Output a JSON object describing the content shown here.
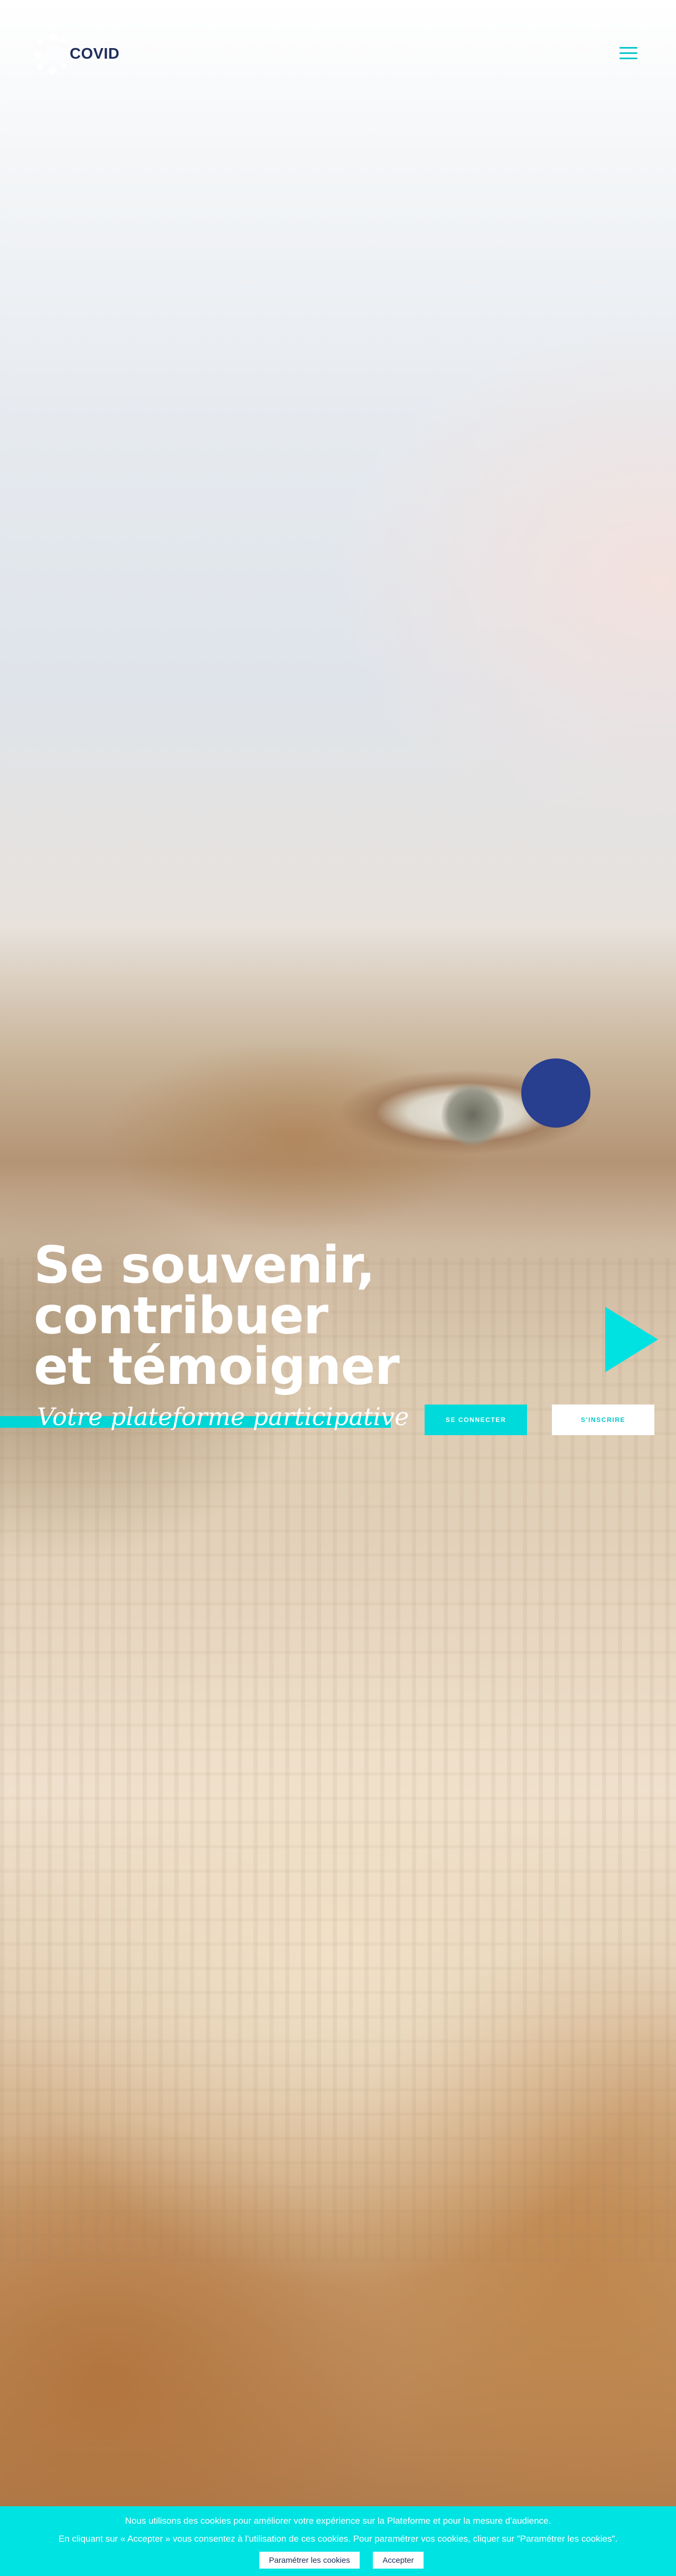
{
  "header": {
    "logo_text": "COVID",
    "logo_icon": "dotted-circle-logo",
    "menu_icon": "hamburger-menu-icon"
  },
  "hero": {
    "title_lines": [
      "Se souvenir,",
      "contribuer",
      "et témoigner"
    ],
    "subtitle": "Votre plateforme participative",
    "login_label": "Se connecter",
    "signup_label": "S'inscrire"
  },
  "cookie_banner": {
    "line1": "Nous utilisons des cookies pour améliorer votre expérience sur la Plateforme et pour la mesure d'audience.",
    "line2": "En cliquant sur « Accepter » vous consentez à l'utilisation de ces cookies. Pour paramétrer vos cookies, cliquer sur \"Paramétrer les cookies\".",
    "settings_label": "Paramétrer les cookies",
    "accept_label": "Accepter"
  },
  "colors": {
    "accent": "#00E1E1",
    "navy": "#1E2D5A",
    "blue_dot": "#283E8F",
    "white": "#FFFFFF"
  },
  "icons": [
    "dotted-circle-logo",
    "hamburger-menu-icon",
    "play-triangle-icon",
    "circle-shape"
  ]
}
